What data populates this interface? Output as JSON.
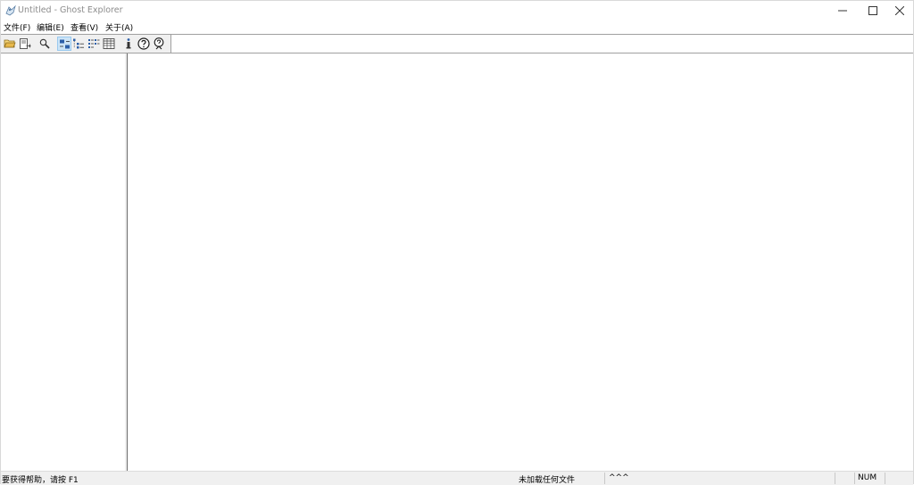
{
  "window": {
    "title": "Untitled - Ghost Explorer"
  },
  "menu": {
    "items": [
      {
        "label": "文件(F)"
      },
      {
        "label": "编辑(E)"
      },
      {
        "label": "查看(V)"
      },
      {
        "label": "关于(A)"
      }
    ]
  },
  "toolbar": {
    "buttons": [
      {
        "icon": "open-folder-icon"
      },
      {
        "icon": "extract-icon"
      },
      {
        "icon": "search-icon"
      },
      {
        "icon": "large-icons-view-icon",
        "pressed": true
      },
      {
        "icon": "small-icons-view-icon"
      },
      {
        "icon": "list-view-icon"
      },
      {
        "icon": "details-view-icon"
      },
      {
        "icon": "info-icon"
      },
      {
        "icon": "help-icon"
      },
      {
        "icon": "context-help-icon"
      }
    ]
  },
  "statusbar": {
    "help_text": "要获得帮助，请按 F1",
    "file_status": "未加载任何文件",
    "extra": "^^^",
    "num_indicator": "NUM"
  },
  "colors": {
    "title_text": "#8c8c8c",
    "toolbar_bg": "#f0f0f0",
    "pressed_bg": "#cce4f7",
    "folder_yellow": "#e8b84a"
  }
}
